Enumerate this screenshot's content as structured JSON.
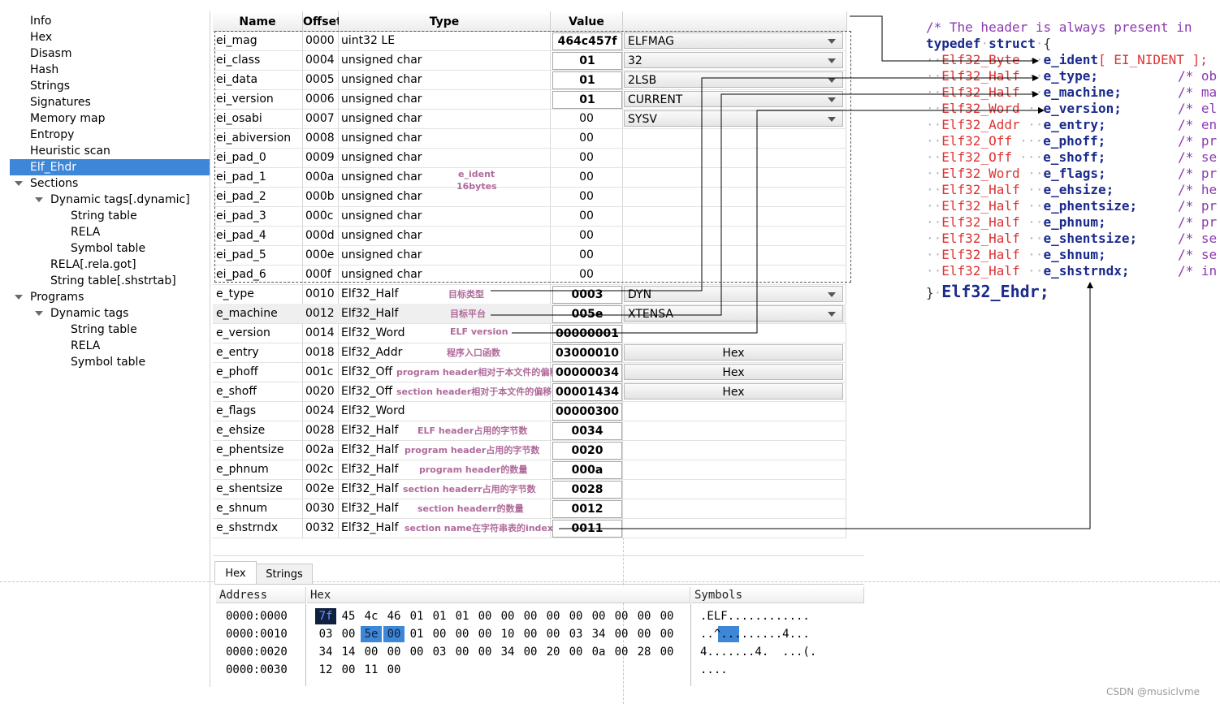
{
  "tree": [
    {
      "label": "Info",
      "level": 0
    },
    {
      "label": "Hex",
      "level": 0
    },
    {
      "label": "Disasm",
      "level": 0
    },
    {
      "label": "Hash",
      "level": 0
    },
    {
      "label": "Strings",
      "level": 0
    },
    {
      "label": "Signatures",
      "level": 0
    },
    {
      "label": "Memory map",
      "level": 0
    },
    {
      "label": "Entropy",
      "level": 0
    },
    {
      "label": "Heuristic scan",
      "level": 0
    },
    {
      "label": "Elf_Ehdr",
      "level": 0,
      "selected": true
    },
    {
      "label": "Sections",
      "level": 0,
      "expanded": true
    },
    {
      "label": "Dynamic tags[.dynamic]",
      "level": 1,
      "expanded": true
    },
    {
      "label": "String table",
      "level": 2
    },
    {
      "label": "RELA",
      "level": 2
    },
    {
      "label": "Symbol table",
      "level": 2
    },
    {
      "label": "RELA[.rela.got]",
      "level": 1
    },
    {
      "label": "String table[.shstrtab]",
      "level": 1
    },
    {
      "label": "Programs",
      "level": 0,
      "expanded": true
    },
    {
      "label": "Dynamic tags",
      "level": 1,
      "expanded": true
    },
    {
      "label": "String table",
      "level": 2
    },
    {
      "label": "RELA",
      "level": 2
    },
    {
      "label": "Symbol table",
      "level": 2
    }
  ],
  "table": {
    "headers": {
      "name": "Name",
      "offset": "Offset",
      "type": "Type",
      "value": "Value"
    },
    "rows": [
      {
        "name": "ei_mag",
        "offset": "0000",
        "type": "uint32 LE",
        "value": "464c457f",
        "extra": "ELFMAG",
        "extra_kind": "combo",
        "boxed": true
      },
      {
        "name": "ei_class",
        "offset": "0004",
        "type": "unsigned char",
        "value": "01",
        "extra": "32",
        "extra_kind": "combo",
        "boxed": true
      },
      {
        "name": "ei_data",
        "offset": "0005",
        "type": "unsigned char",
        "value": "01",
        "extra": "2LSB",
        "extra_kind": "combo",
        "boxed": true
      },
      {
        "name": "ei_version",
        "offset": "0006",
        "type": "unsigned char",
        "value": "01",
        "extra": "CURRENT",
        "extra_kind": "combo",
        "boxed": true
      },
      {
        "name": "ei_osabi",
        "offset": "0007",
        "type": "unsigned char",
        "value": "00",
        "extra": "SYSV",
        "extra_kind": "combo",
        "boxed": false
      },
      {
        "name": "ei_abiversion",
        "offset": "0008",
        "type": "unsigned char",
        "value": "00",
        "extra": "",
        "extra_kind": "none",
        "boxed": false
      },
      {
        "name": "ei_pad_0",
        "offset": "0009",
        "type": "unsigned char",
        "value": "00",
        "extra": "",
        "extra_kind": "none",
        "boxed": false
      },
      {
        "name": "ei_pad_1",
        "offset": "000a",
        "type": "unsigned char",
        "value": "00",
        "extra": "",
        "extra_kind": "none",
        "boxed": false
      },
      {
        "name": "ei_pad_2",
        "offset": "000b",
        "type": "unsigned char",
        "value": "00",
        "extra": "",
        "extra_kind": "none",
        "boxed": false
      },
      {
        "name": "ei_pad_3",
        "offset": "000c",
        "type": "unsigned char",
        "value": "00",
        "extra": "",
        "extra_kind": "none",
        "boxed": false
      },
      {
        "name": "ei_pad_4",
        "offset": "000d",
        "type": "unsigned char",
        "value": "00",
        "extra": "",
        "extra_kind": "none",
        "boxed": false
      },
      {
        "name": "ei_pad_5",
        "offset": "000e",
        "type": "unsigned char",
        "value": "00",
        "extra": "",
        "extra_kind": "none",
        "boxed": false
      },
      {
        "name": "ei_pad_6",
        "offset": "000f",
        "type": "unsigned char",
        "value": "00",
        "extra": "",
        "extra_kind": "none",
        "boxed": false
      },
      {
        "name": "e_type",
        "offset": "0010",
        "type": "Elf32_Half",
        "value": "0003",
        "extra": "DYN",
        "extra_kind": "combo",
        "boxed": true,
        "note": "目标类型"
      },
      {
        "name": "e_machine",
        "offset": "0012",
        "type": "Elf32_Half",
        "value": "005e",
        "extra": "XTENSA",
        "extra_kind": "combo",
        "boxed": true,
        "note": "目标平台"
      },
      {
        "name": "e_version",
        "offset": "0014",
        "type": "Elf32_Word",
        "value": "00000001",
        "extra": "",
        "extra_kind": "none",
        "boxed": true,
        "note": "ELF version"
      },
      {
        "name": "e_entry",
        "offset": "0018",
        "type": "Elf32_Addr",
        "value": "03000010",
        "extra": "Hex",
        "extra_kind": "button",
        "boxed": true,
        "note": "程序入口函数"
      },
      {
        "name": "e_phoff",
        "offset": "001c",
        "type": "Elf32_Off",
        "value": "00000034",
        "extra": "Hex",
        "extra_kind": "button",
        "boxed": true,
        "note": "program header相对于本文件的偏移"
      },
      {
        "name": "e_shoff",
        "offset": "0020",
        "type": "Elf32_Off",
        "value": "00001434",
        "extra": "Hex",
        "extra_kind": "button",
        "boxed": true,
        "note": "section header相对于本文件的偏移"
      },
      {
        "name": "e_flags",
        "offset": "0024",
        "type": "Elf32_Word",
        "value": "00000300",
        "extra": "",
        "extra_kind": "none",
        "boxed": true
      },
      {
        "name": "e_ehsize",
        "offset": "0028",
        "type": "Elf32_Half",
        "value": "0034",
        "extra": "",
        "extra_kind": "none",
        "boxed": true,
        "note": "ELF header占用的字节数"
      },
      {
        "name": "e_phentsize",
        "offset": "002a",
        "type": "Elf32_Half",
        "value": "0020",
        "extra": "",
        "extra_kind": "none",
        "boxed": true,
        "note": "program header占用的字节数"
      },
      {
        "name": "e_phnum",
        "offset": "002c",
        "type": "Elf32_Half",
        "value": "000a",
        "extra": "",
        "extra_kind": "none",
        "boxed": true,
        "note": "program header的数量"
      },
      {
        "name": "e_shentsize",
        "offset": "002e",
        "type": "Elf32_Half",
        "value": "0028",
        "extra": "",
        "extra_kind": "none",
        "boxed": true,
        "note": "section headerr占用的字节数"
      },
      {
        "name": "e_shnum",
        "offset": "0030",
        "type": "Elf32_Half",
        "value": "0012",
        "extra": "",
        "extra_kind": "none",
        "boxed": true,
        "note": "section headerr的数量"
      },
      {
        "name": "e_shstrndx",
        "offset": "0032",
        "type": "Elf32_Half",
        "value": "0011",
        "extra": "",
        "extra_kind": "none",
        "boxed": true,
        "note": "section name在字符串表的index"
      }
    ],
    "ident_note_line1": "e_ident",
    "ident_note_line2": "16bytes"
  },
  "tabs": [
    "Hex",
    "Strings"
  ],
  "hex": {
    "headers": {
      "address": "Address",
      "hex": "Hex",
      "symbols": "Symbols"
    },
    "rows": [
      {
        "address": "0000:0000",
        "bytes": [
          "7f",
          "45",
          "4c",
          "46",
          "01",
          "01",
          "01",
          "00",
          "00",
          "00",
          "00",
          "00",
          "00",
          "00",
          "00",
          "00"
        ],
        "symbols": ".ELF............"
      },
      {
        "address": "0000:0010",
        "bytes": [
          "03",
          "00",
          "5e",
          "00",
          "01",
          "00",
          "00",
          "00",
          "10",
          "00",
          "00",
          "03",
          "34",
          "00",
          "00",
          "00"
        ],
        "symbols": "..^.........4..."
      },
      {
        "address": "0000:0020",
        "bytes": [
          "34",
          "14",
          "00",
          "00",
          "00",
          "03",
          "00",
          "00",
          "34",
          "00",
          "20",
          "00",
          "0a",
          "00",
          "28",
          "00"
        ],
        "symbols": "4.......4.  ...(."
      },
      {
        "address": "0000:0030",
        "bytes": [
          "12",
          "00",
          "11",
          "00"
        ],
        "symbols": "...."
      }
    ]
  },
  "code": {
    "comment": "/* The header is always present in",
    "typedef_kw": "typedef",
    "struct_kw": "struct",
    "open_brace": "{",
    "fields": [
      {
        "type": "Elf32_Byte",
        "name": "e_ident",
        "suffix": "[ EI_NIDENT ];",
        "comment": ""
      },
      {
        "type": "Elf32_Half",
        "name": "e_type;",
        "suffix": "",
        "comment": "/* ob"
      },
      {
        "type": "Elf32_Half",
        "name": "e_machine;",
        "suffix": "",
        "comment": "/* ma"
      },
      {
        "type": "Elf32_Word",
        "name": "e_version;",
        "suffix": "",
        "comment": "/* el"
      },
      {
        "type": "Elf32_Addr",
        "name": "e_entry;",
        "suffix": "",
        "comment": "/* en"
      },
      {
        "type": "Elf32_Off",
        "name": "e_phoff;",
        "suffix": "",
        "comment": "/* pr"
      },
      {
        "type": "Elf32_Off",
        "name": "e_shoff;",
        "suffix": "",
        "comment": "/* se"
      },
      {
        "type": "Elf32_Word",
        "name": "e_flags;",
        "suffix": "",
        "comment": "/* pr"
      },
      {
        "type": "Elf32_Half",
        "name": "e_ehsize;",
        "suffix": "",
        "comment": "/* he"
      },
      {
        "type": "Elf32_Half",
        "name": "e_phentsize;",
        "suffix": "",
        "comment": "/* pr"
      },
      {
        "type": "Elf32_Half",
        "name": "e_phnum;",
        "suffix": "",
        "comment": "/* pr"
      },
      {
        "type": "Elf32_Half",
        "name": "e_shentsize;",
        "suffix": "",
        "comment": "/* se"
      },
      {
        "type": "Elf32_Half",
        "name": "e_shnum;",
        "suffix": "",
        "comment": "/* se"
      },
      {
        "type": "Elf32_Half",
        "name": "e_shstrndx;",
        "suffix": "",
        "comment": "/* in"
      }
    ],
    "close_brace": "}",
    "struct_name": "Elf32_Ehdr;"
  },
  "watermark": "CSDN @musiclvme",
  "colors": {
    "selection": "#3d86d8",
    "annotation": "#b06a9a",
    "code_type": "#dd3333",
    "code_keyword": "#1a2a8c",
    "code_comment": "#8b3ab0"
  }
}
